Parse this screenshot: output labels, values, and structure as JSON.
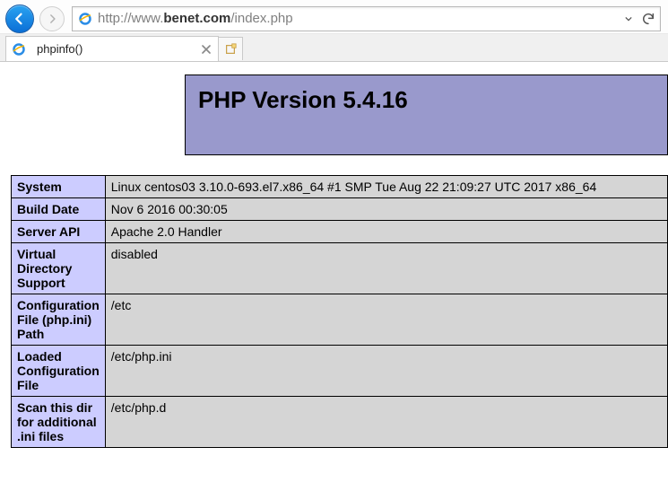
{
  "browser": {
    "url_prefix": "http://www.",
    "url_bold": "benet.com",
    "url_suffix": "/index.php"
  },
  "tab": {
    "title": "phpinfo()"
  },
  "php_header": "PHP Version 5.4.16",
  "rows": [
    {
      "k": "System",
      "v": "Linux centos03 3.10.0-693.el7.x86_64 #1 SMP Tue Aug 22 21:09:27 UTC 2017 x86_64"
    },
    {
      "k": "Build Date",
      "v": "Nov 6 2016 00:30:05"
    },
    {
      "k": "Server API",
      "v": "Apache 2.0 Handler"
    },
    {
      "k": "Virtual Directory Support",
      "v": "disabled"
    },
    {
      "k": "Configuration File (php.ini) Path",
      "v": "/etc"
    },
    {
      "k": "Loaded Configuration File",
      "v": "/etc/php.ini"
    },
    {
      "k": "Scan this dir for additional .ini files",
      "v": "/etc/php.d"
    }
  ]
}
